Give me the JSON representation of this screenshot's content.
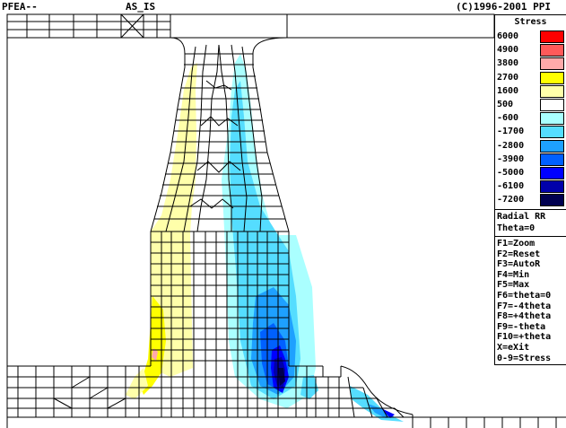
{
  "titlebar": {
    "app": "PFEA--",
    "mode": "AS_IS",
    "copyright": "(C)1996-2001 PPI"
  },
  "legend": {
    "title": "Stress",
    "levels": [
      {
        "label": "6000",
        "color": "#ff0000"
      },
      {
        "label": "4900",
        "color": "#ff5a5a"
      },
      {
        "label": "3800",
        "color": "#ffaaaa"
      },
      {
        "label": "2700",
        "color": "#ffff00"
      },
      {
        "label": "1600",
        "color": "#ffffaa"
      },
      {
        "label": "500",
        "color": "#ffffff"
      },
      {
        "label": "-600",
        "color": "#aaffff"
      },
      {
        "label": "-1700",
        "color": "#55ddff"
      },
      {
        "label": "-2800",
        "color": "#1ea0ff"
      },
      {
        "label": "-3900",
        "color": "#0060ff"
      },
      {
        "label": "-5000",
        "color": "#0000ff"
      },
      {
        "label": "-6100",
        "color": "#0000aa"
      },
      {
        "label": "-7200",
        "color": "#000050"
      }
    ]
  },
  "view": {
    "component": "Radial RR",
    "theta": "Theta=0"
  },
  "keys": [
    "F1=Zoom",
    "F2=Reset",
    "F3=AutoR",
    "F4=Min",
    "F5=Max",
    "F6=theta=0",
    "F7=-4theta",
    "F8=+4theta",
    "F9=-theta",
    "F10=+theta",
    "X=eXit",
    "0-9=Stress"
  ]
}
